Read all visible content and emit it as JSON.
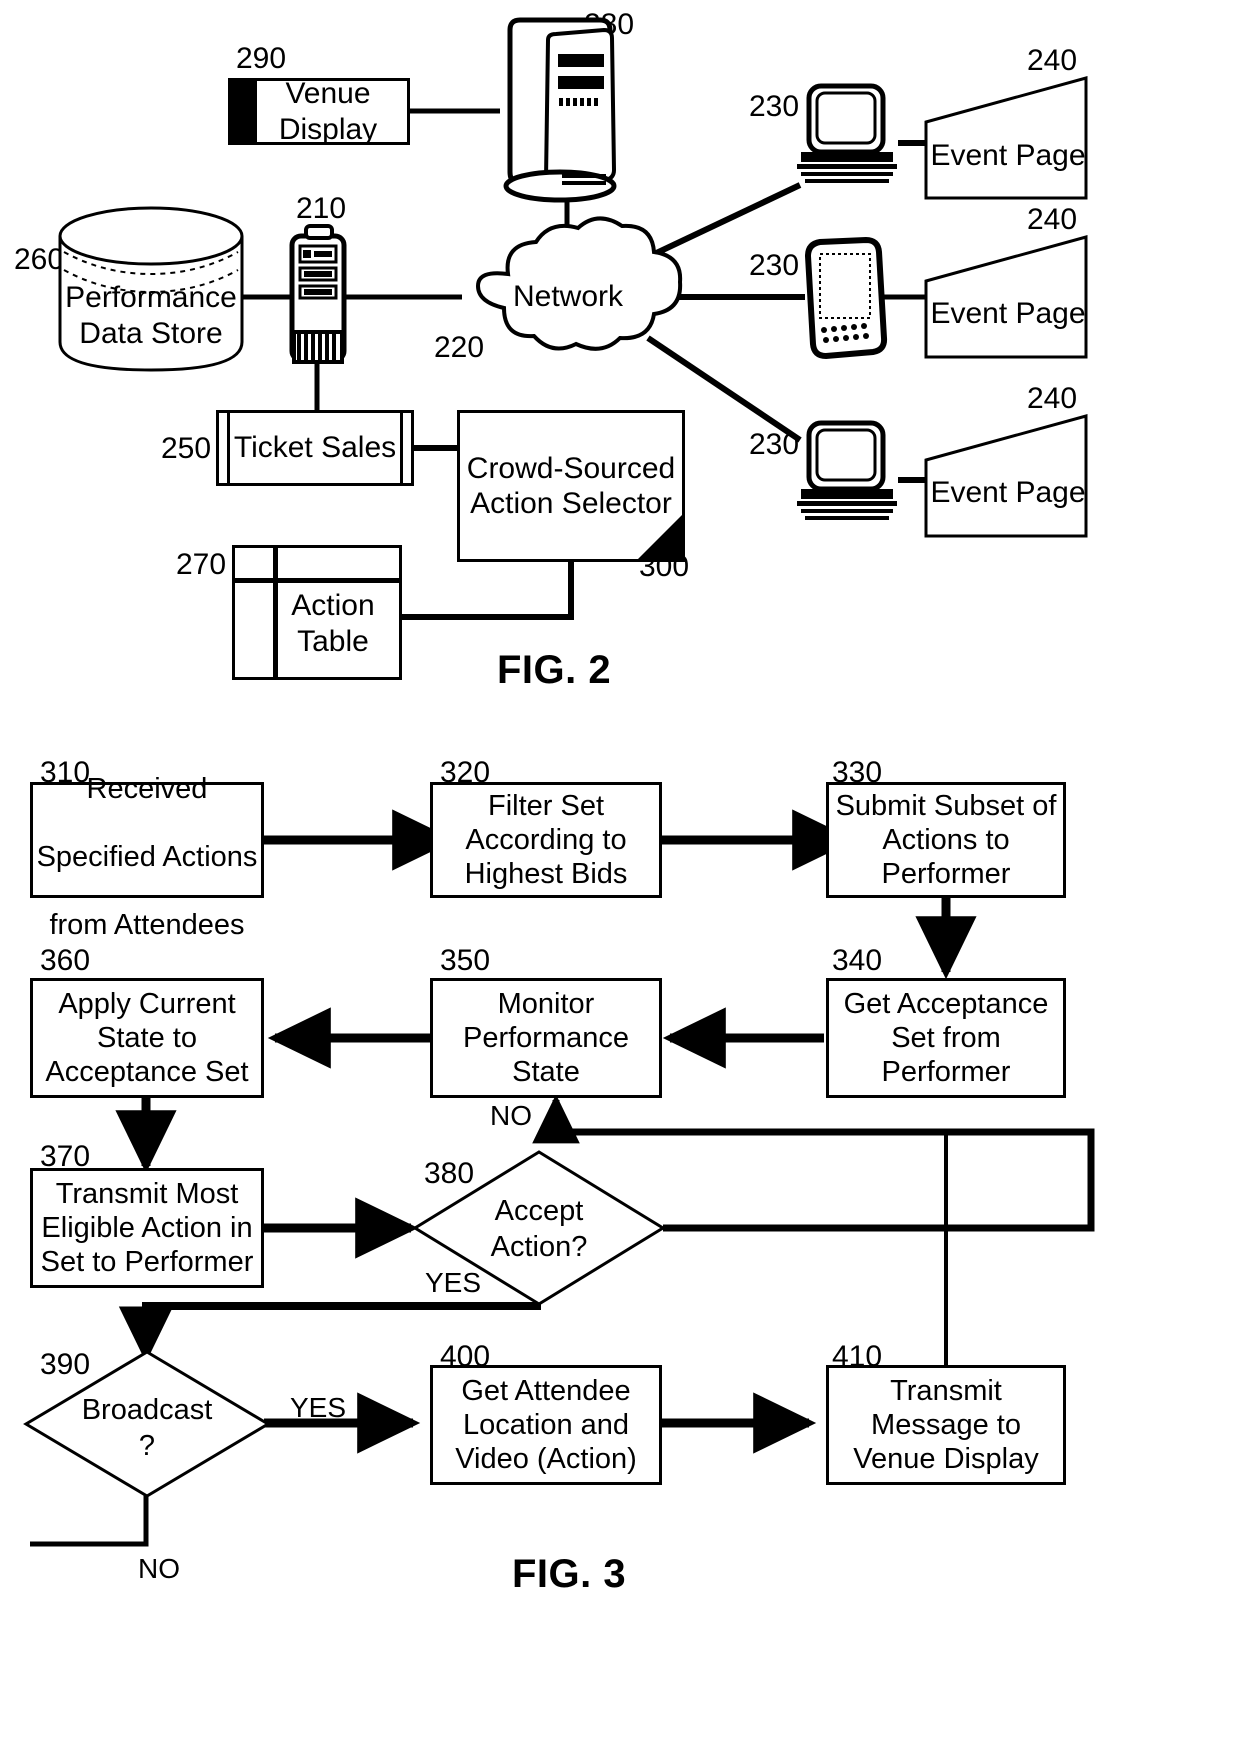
{
  "figure2": {
    "caption": "FIG. 2",
    "nodes": [
      {
        "id": "venue_display",
        "ref": "290",
        "label": "Venue\nDisplay",
        "kind": "display-box"
      },
      {
        "id": "server_280",
        "ref": "280",
        "label": "",
        "kind": "tower-server-icon"
      },
      {
        "id": "app_server",
        "ref": "210",
        "label": "",
        "kind": "rack-server-icon"
      },
      {
        "id": "data_store",
        "ref": "260",
        "label": "Performance\nData Store",
        "kind": "cylinder-database"
      },
      {
        "id": "network",
        "ref": "220",
        "label": "Network",
        "kind": "cloud"
      },
      {
        "id": "ticket_sales",
        "ref": "250",
        "label": "Ticket Sales",
        "kind": "document-box"
      },
      {
        "id": "action_selector",
        "ref": "300",
        "label": "Crowd-Sourced\nAction Selector",
        "kind": "box-with-corner-triangle"
      },
      {
        "id": "action_table",
        "ref": "270",
        "label": "Action\nTable",
        "kind": "table-icon"
      },
      {
        "id": "client_1",
        "ref": "230",
        "label": "",
        "kind": "desktop-computer-icon"
      },
      {
        "id": "client_2",
        "ref": "230",
        "label": "",
        "kind": "pda-device-icon"
      },
      {
        "id": "client_3",
        "ref": "230",
        "label": "",
        "kind": "desktop-computer-icon"
      },
      {
        "id": "event_page_1",
        "ref": "240",
        "label": "Event Page",
        "kind": "page-trapezoid"
      },
      {
        "id": "event_page_2",
        "ref": "240",
        "label": "Event Page",
        "kind": "page-trapezoid"
      },
      {
        "id": "event_page_3",
        "ref": "240",
        "label": "Event Page",
        "kind": "page-trapezoid"
      }
    ]
  },
  "figure3": {
    "caption": "FIG. 3",
    "nodes": [
      {
        "id": "n310",
        "ref": "310",
        "shape": "process",
        "lines": [
          "Received",
          "Specified Actions",
          "from Attendees"
        ]
      },
      {
        "id": "n320",
        "ref": "320",
        "shape": "process",
        "lines": [
          "Filter Set",
          "According to",
          "Highest Bids"
        ]
      },
      {
        "id": "n330",
        "ref": "330",
        "shape": "process",
        "lines": [
          "Submit Subset of",
          "Actions to",
          "Performer"
        ]
      },
      {
        "id": "n340",
        "ref": "340",
        "shape": "process",
        "lines": [
          "Get Acceptance",
          "Set from",
          "Performer"
        ]
      },
      {
        "id": "n350",
        "ref": "350",
        "shape": "process",
        "lines": [
          "Monitor",
          "Performance",
          "State"
        ]
      },
      {
        "id": "n360",
        "ref": "360",
        "shape": "process",
        "lines": [
          "Apply Current",
          "State to",
          "Acceptance Set"
        ]
      },
      {
        "id": "n370",
        "ref": "370",
        "shape": "process",
        "lines": [
          "Transmit Most",
          "Eligible Action in",
          "Set to Performer"
        ]
      },
      {
        "id": "n380",
        "ref": "380",
        "shape": "decision",
        "lines": [
          "Accept",
          "Action?"
        ]
      },
      {
        "id": "n390",
        "ref": "390",
        "shape": "decision",
        "lines": [
          "Broadcast",
          "?"
        ]
      },
      {
        "id": "n400",
        "ref": "400",
        "shape": "process",
        "lines": [
          "Get Attendee",
          "Location and",
          "Video (Action)"
        ]
      },
      {
        "id": "n410",
        "ref": "410",
        "shape": "process",
        "lines": [
          "Transmit",
          "Message to",
          "Venue Display"
        ]
      }
    ],
    "edge_labels": {
      "accept_no": "NO",
      "accept_yes": "YES",
      "broadcast_yes": "YES",
      "broadcast_no": "NO"
    }
  }
}
